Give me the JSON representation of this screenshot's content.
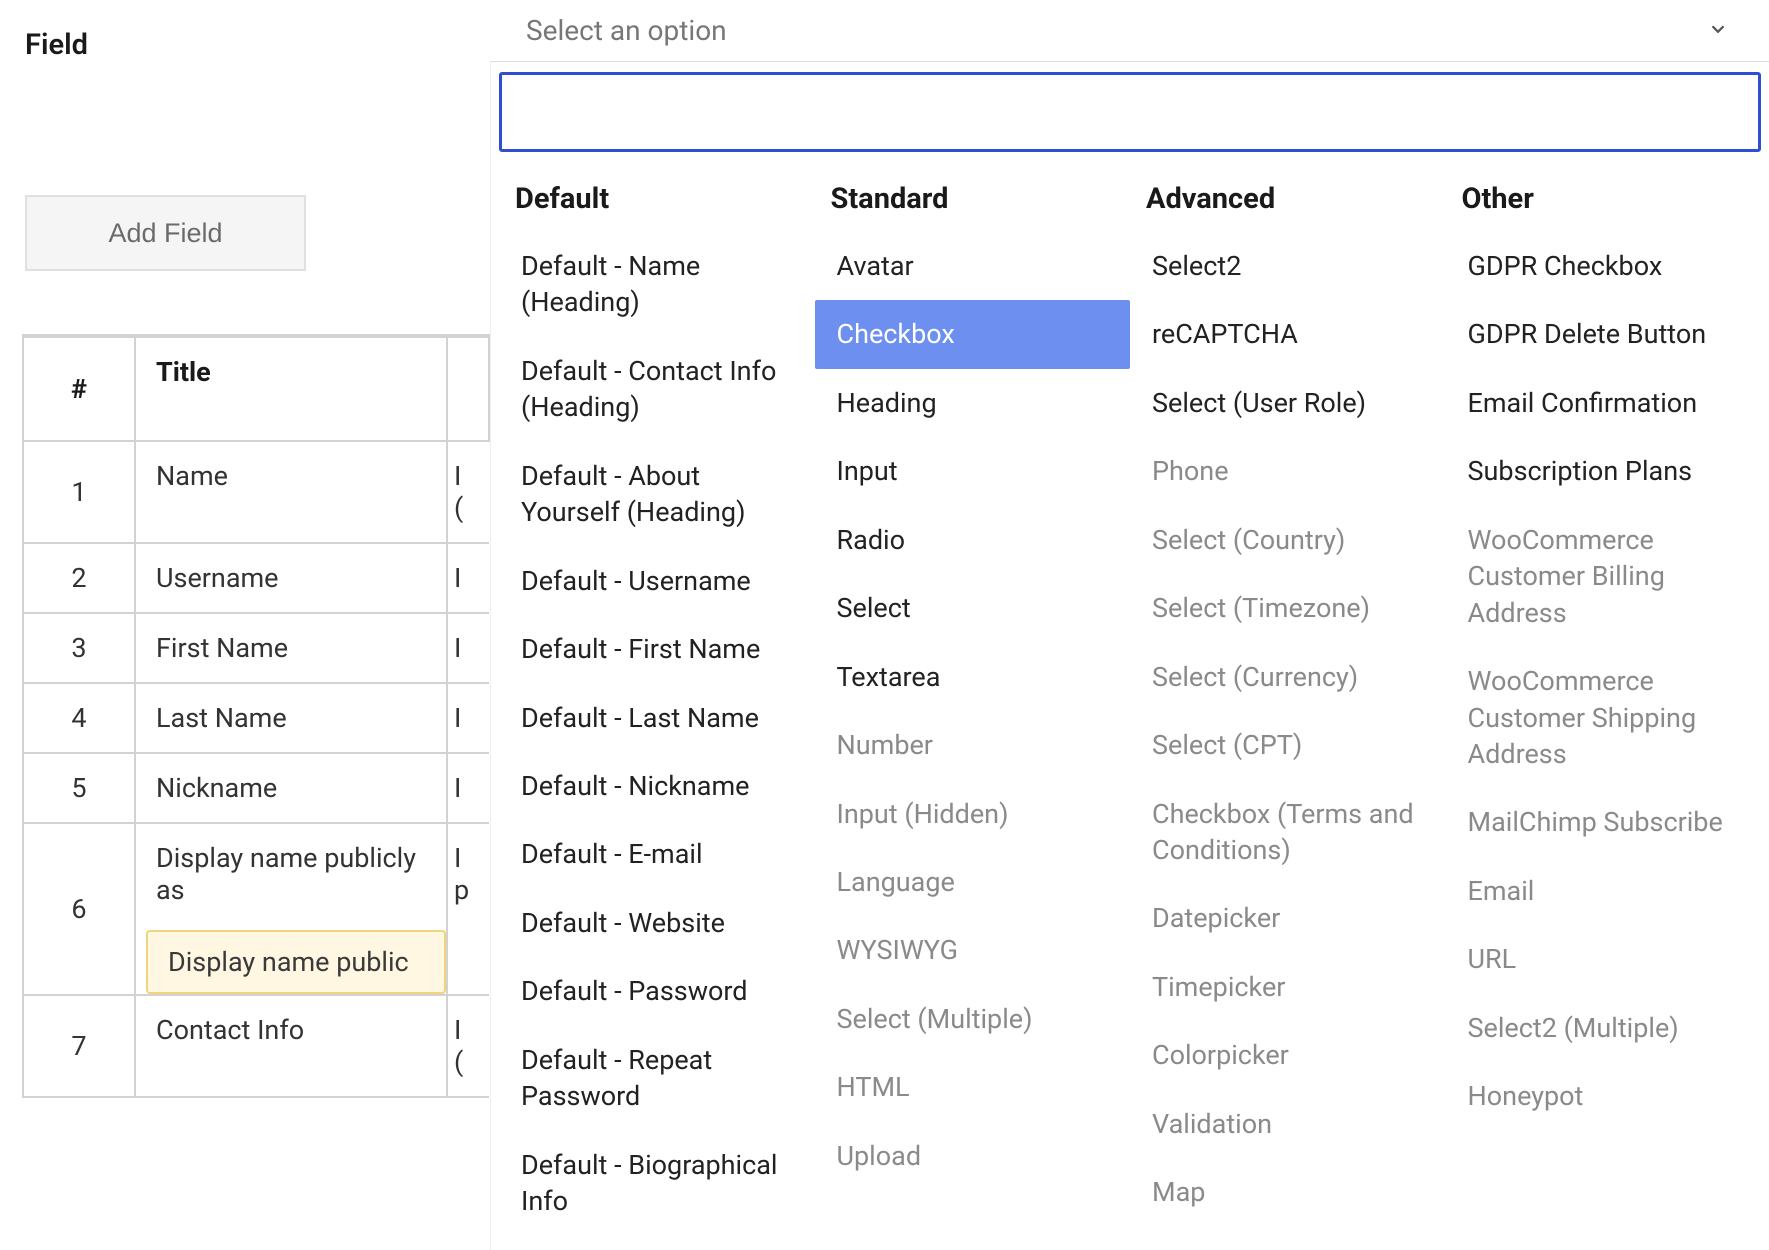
{
  "field_label": "Field",
  "dropdown_placeholder": "Select an option",
  "add_field_label": "Add Field",
  "table": {
    "headers": {
      "num": "#",
      "title": "Title"
    },
    "rows": [
      {
        "num": "1",
        "title": "Name",
        "right": "I\n("
      },
      {
        "num": "2",
        "title": "Username",
        "right": "I"
      },
      {
        "num": "3",
        "title": "First Name",
        "right": "I"
      },
      {
        "num": "4",
        "title": "Last Name",
        "right": "I"
      },
      {
        "num": "5",
        "title": "Nickname",
        "right": "I"
      },
      {
        "num": "6",
        "title": "Display name publicly as",
        "right": "I\np",
        "tooltip": "Display name public"
      },
      {
        "num": "7",
        "title": "Contact Info",
        "right": "I\n("
      }
    ]
  },
  "panel": {
    "search_value": "",
    "columns": [
      {
        "header": "Default",
        "options": [
          {
            "label": "Default - Name (Heading)",
            "muted": false
          },
          {
            "label": "Default - Contact Info (Heading)",
            "muted": false
          },
          {
            "label": "Default - About Yourself (Heading)",
            "muted": false
          },
          {
            "label": "Default - Username",
            "muted": false
          },
          {
            "label": "Default - First Name",
            "muted": false
          },
          {
            "label": "Default - Last Name",
            "muted": false
          },
          {
            "label": "Default - Nickname",
            "muted": false
          },
          {
            "label": "Default - E-mail",
            "muted": false
          },
          {
            "label": "Default - Website",
            "muted": false
          },
          {
            "label": "Default - Password",
            "muted": false
          },
          {
            "label": "Default - Repeat Password",
            "muted": false
          },
          {
            "label": "Default - Biographical Info",
            "muted": false
          }
        ]
      },
      {
        "header": "Standard",
        "options": [
          {
            "label": "Avatar",
            "muted": false
          },
          {
            "label": "Checkbox",
            "muted": false,
            "highlight": true
          },
          {
            "label": "Heading",
            "muted": false
          },
          {
            "label": "Input",
            "muted": false
          },
          {
            "label": "Radio",
            "muted": false
          },
          {
            "label": "Select",
            "muted": false
          },
          {
            "label": "Textarea",
            "muted": false
          },
          {
            "label": "Number",
            "muted": true
          },
          {
            "label": "Input (Hidden)",
            "muted": true
          },
          {
            "label": "Language",
            "muted": true
          },
          {
            "label": "WYSIWYG",
            "muted": true
          },
          {
            "label": "Select (Multiple)",
            "muted": true
          },
          {
            "label": "HTML",
            "muted": true
          },
          {
            "label": "Upload",
            "muted": true
          }
        ]
      },
      {
        "header": "Advanced",
        "options": [
          {
            "label": "Select2",
            "muted": false
          },
          {
            "label": "reCAPTCHA",
            "muted": false
          },
          {
            "label": "Select (User Role)",
            "muted": false
          },
          {
            "label": "Phone",
            "muted": true
          },
          {
            "label": "Select (Country)",
            "muted": true
          },
          {
            "label": "Select (Timezone)",
            "muted": true
          },
          {
            "label": "Select (Currency)",
            "muted": true
          },
          {
            "label": "Select (CPT)",
            "muted": true
          },
          {
            "label": "Checkbox (Terms and Conditions)",
            "muted": true
          },
          {
            "label": "Datepicker",
            "muted": true
          },
          {
            "label": "Timepicker",
            "muted": true
          },
          {
            "label": "Colorpicker",
            "muted": true
          },
          {
            "label": "Validation",
            "muted": true
          },
          {
            "label": "Map",
            "muted": true
          }
        ]
      },
      {
        "header": "Other",
        "options": [
          {
            "label": "GDPR Checkbox",
            "muted": false
          },
          {
            "label": "GDPR Delete Button",
            "muted": false
          },
          {
            "label": "Email Confirmation",
            "muted": false
          },
          {
            "label": "Subscription Plans",
            "muted": false
          },
          {
            "label": "WooCommerce Customer Billing Address",
            "muted": true
          },
          {
            "label": "WooCommerce Customer Shipping Address",
            "muted": true
          },
          {
            "label": "MailChimp Subscribe",
            "muted": true
          },
          {
            "label": "Email",
            "muted": true
          },
          {
            "label": "URL",
            "muted": true
          },
          {
            "label": "Select2 (Multiple)",
            "muted": true
          },
          {
            "label": "Honeypot",
            "muted": true
          }
        ]
      }
    ]
  }
}
